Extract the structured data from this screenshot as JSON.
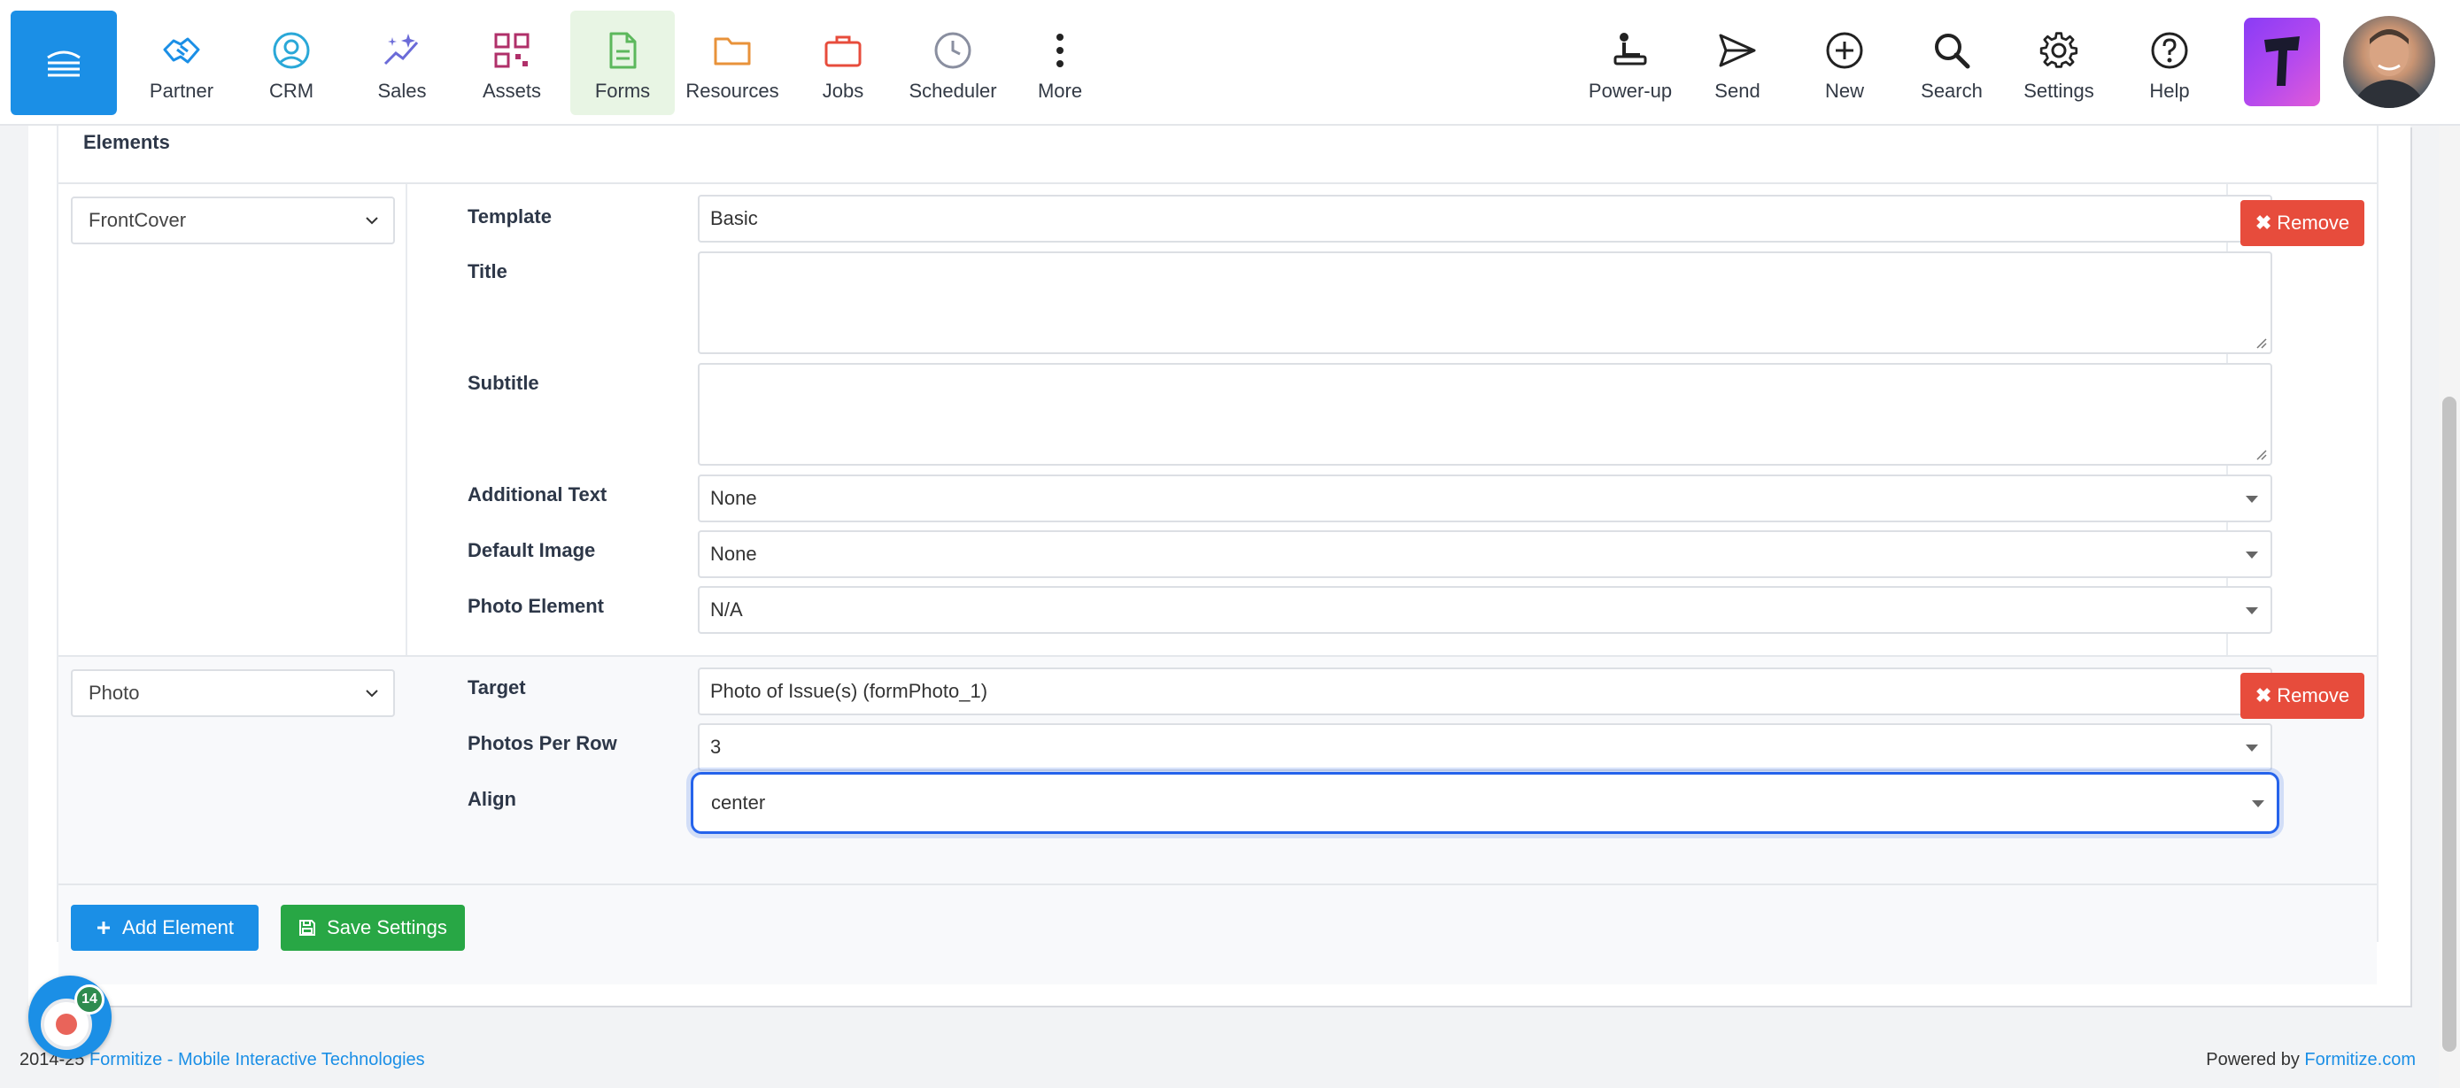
{
  "nav": {
    "items": [
      {
        "label": "Partner",
        "icon": "handshake-icon",
        "color": "#1b8fe6"
      },
      {
        "label": "CRM",
        "icon": "user-circle-icon",
        "color": "#2aa8d8"
      },
      {
        "label": "Sales",
        "icon": "sparkle-chart-icon",
        "color": "#6b6bd8"
      },
      {
        "label": "Assets",
        "icon": "qr-code-icon",
        "color": "#b0306a"
      },
      {
        "label": "Forms",
        "icon": "document-icon",
        "color": "#5cb85c"
      },
      {
        "label": "Resources",
        "icon": "folder-icon",
        "color": "#e8923a"
      },
      {
        "label": "Jobs",
        "icon": "briefcase-icon",
        "color": "#e74c3c"
      },
      {
        "label": "Scheduler",
        "icon": "clock-icon",
        "color": "#8a8fa0"
      },
      {
        "label": "More",
        "icon": "kebab-icon",
        "color": "#222222"
      }
    ],
    "active": "Forms",
    "utilities": [
      {
        "label": "Power-up",
        "icon": "power-up-icon"
      },
      {
        "label": "Send",
        "icon": "paper-plane-icon"
      },
      {
        "label": "New",
        "icon": "plus-circle-icon"
      },
      {
        "label": "Search",
        "icon": "search-icon"
      },
      {
        "label": "Settings",
        "icon": "gear-icon"
      },
      {
        "label": "Help",
        "icon": "help-circle-icon"
      }
    ]
  },
  "panel": {
    "header_label": "Elements",
    "field_labels": {
      "template": "Template",
      "title": "Title",
      "subtitle": "Subtitle",
      "additional_text": "Additional Text",
      "default_image": "Default Image",
      "photo_element": "Photo Element",
      "target": "Target",
      "photos_per_row": "Photos Per Row",
      "align": "Align"
    },
    "front_cover": {
      "element_type": "FrontCover",
      "template": "Basic",
      "title": "",
      "subtitle": "",
      "additional_text": "None",
      "default_image": "None",
      "photo_element": "N/A"
    },
    "photo": {
      "element_type": "Photo",
      "target": "Photo of Issue(s) (formPhoto_1)",
      "photos_per_row": "3",
      "align": "center"
    },
    "remove_label": "Remove",
    "add_element_label": "Add Element",
    "save_settings_label": "Save Settings"
  },
  "footer": {
    "copyright_prefix": "2014-25 ",
    "company_link": "Formitize - Mobile Interactive Technologies",
    "powered_by": "Powered by ",
    "powered_link": "Formitize.com"
  },
  "recorder": {
    "badge_count": "14"
  },
  "colors": {
    "primary": "#1b8fe6",
    "danger": "#e74c3c",
    "success": "#28a745",
    "focus": "#2563eb"
  }
}
